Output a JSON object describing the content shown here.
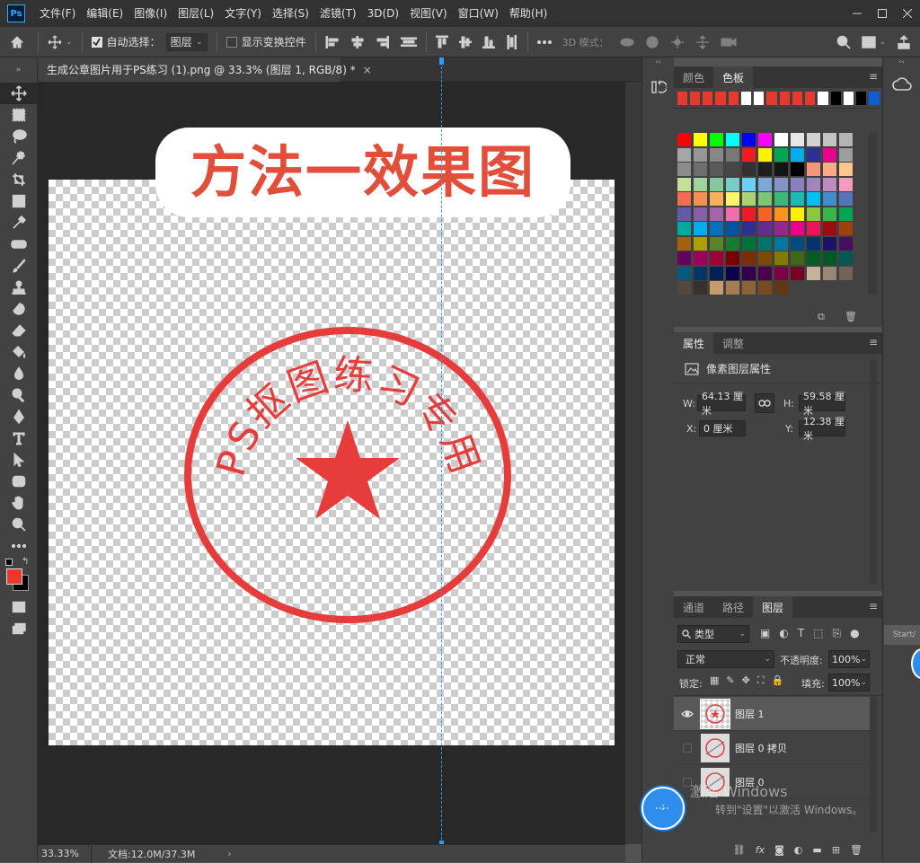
{
  "app": {
    "menu": [
      "文件(F)",
      "编辑(E)",
      "图像(I)",
      "图层(L)",
      "文字(Y)",
      "选择(S)",
      "滤镜(T)",
      "3D(D)",
      "视图(V)",
      "窗口(W)",
      "帮助(H)"
    ],
    "logo_text": "Ps"
  },
  "options": {
    "auto_select_label": "自动选择：",
    "auto_select_target": "图层",
    "show_transform_label": "显示变换控件",
    "mode_3d_label": "3D 模式："
  },
  "document": {
    "tab_title": "生成公章图片用于PS练习 (1).png @ 33.3% (图层 1, RGB/8) *",
    "close_glyph": "×",
    "banner_text": "方法一效果图",
    "seal_text": "PS抠图练习专用",
    "seal_color": "#e63c3c"
  },
  "status": {
    "zoom": "33.33%",
    "doc_info": "文档:12.0M/37.3M",
    "arrow": "›"
  },
  "swatch_panel": {
    "tabs": [
      "颜色",
      "色板"
    ],
    "active_tab": "色板",
    "recent": [
      "#e53a2e",
      "#e53a2e",
      "#e53a2e",
      "#e53a2e",
      "#e53a2e",
      "#ffffff",
      "#ffffff",
      "#e53a2e",
      "#e53a2e",
      "#e53a2e",
      "#e53a2e",
      "#ffffff",
      "#000000",
      "#ffffff",
      "#000000",
      "#0b5fd6"
    ],
    "grid": [
      [
        "#ff0000",
        "#ffff00",
        "#00ff00",
        "#00ffff",
        "#0000ff",
        "#ff00ff",
        "#ffffff",
        "#e6e6e6",
        "#d2d2d2",
        "#c3c3c3",
        "#b4b4b4"
      ],
      [
        "#a5a5a5",
        "#969696",
        "#878787",
        "#787878",
        "#ec1c24",
        "#fff200",
        "#00a651",
        "#00aeef",
        "#2e3192",
        "#ec008c",
        "#9e9e9e"
      ],
      [
        "#8c8c8c",
        "#6e6e6e",
        "#5a5a5a",
        "#464646",
        "#323232",
        "#1e1e1e",
        "#141414",
        "#000000",
        "#f7977a",
        "#fbad82",
        "#fdc68c"
      ],
      [
        "#c4df9b",
        "#a3d39c",
        "#82ca9d",
        "#7accc8",
        "#6dcff6",
        "#7da7d8",
        "#8393ca",
        "#8781bd",
        "#a186be",
        "#bd8cbf",
        "#f49ac1"
      ],
      [
        "#f26c4f",
        "#f68e56",
        "#fbaf5d",
        "#fff568",
        "#acd372",
        "#7cc576",
        "#3bb878",
        "#1abbb4",
        "#00bff3",
        "#438ccb",
        "#5574b9"
      ],
      [
        "#605ca8",
        "#855fa8",
        "#a763a8",
        "#f06eaa",
        "#ed1c24",
        "#f26522",
        "#f7941d",
        "#fff200",
        "#8dc63f",
        "#39b54a",
        "#00a651"
      ],
      [
        "#00a99d",
        "#00aeef",
        "#0072bc",
        "#0054a6",
        "#2e3192",
        "#662d91",
        "#92278f",
        "#ec008c",
        "#ed145b",
        "#9e0b0f",
        "#a0410d"
      ],
      [
        "#a36209",
        "#aba000",
        "#598527",
        "#197b30",
        "#007236",
        "#00746b",
        "#0076a3",
        "#004b80",
        "#003471",
        "#1b1464",
        "#440e62"
      ],
      [
        "#630460",
        "#9e005d",
        "#9e0039",
        "#790000",
        "#7b2e00",
        "#7d4900",
        "#827b00",
        "#406618",
        "#005e20",
        "#005826",
        "#005952"
      ],
      [
        "#005b7f",
        "#003663",
        "#002157",
        "#0d004c",
        "#32004b",
        "#4b0049",
        "#7b0046",
        "#7a0026",
        "#c7b299",
        "#998675",
        "#736357"
      ],
      [
        "#534741",
        "#37302d",
        "#c69c6d",
        "#a67c52",
        "#8c6239",
        "#754c24",
        "#603913"
      ]
    ]
  },
  "properties_panel": {
    "tabs": [
      "属性",
      "调整"
    ],
    "active_tab": "属性",
    "section_title": "像素图层属性",
    "w_label": "W:",
    "w_value": "64.13 厘米",
    "h_label": "H:",
    "h_value": "59.58 厘米",
    "x_label": "X:",
    "x_value": "0 厘米",
    "y_label": "Y:",
    "y_value": "12.38 厘米"
  },
  "layers_panel": {
    "tabs": [
      "通道",
      "路径",
      "图层"
    ],
    "active_tab": "图层",
    "filter_kind": "类型",
    "blend_mode": "正常",
    "opacity_label": "不透明度:",
    "opacity_value": "100%",
    "lock_label": "锁定:",
    "fill_label": "填充:",
    "fill_value": "100%",
    "layers": [
      {
        "name": "图层 1",
        "visible": true,
        "selected": true
      },
      {
        "name": "图层 0 拷贝",
        "visible": false,
        "selected": false
      },
      {
        "name": "图层 0",
        "visible": false,
        "selected": false
      }
    ]
  },
  "overlay": {
    "watermark_line1": "激活 Windows",
    "watermark_line2": "转到\"设置\"以激活 Windows。",
    "start_label": "Start/"
  }
}
